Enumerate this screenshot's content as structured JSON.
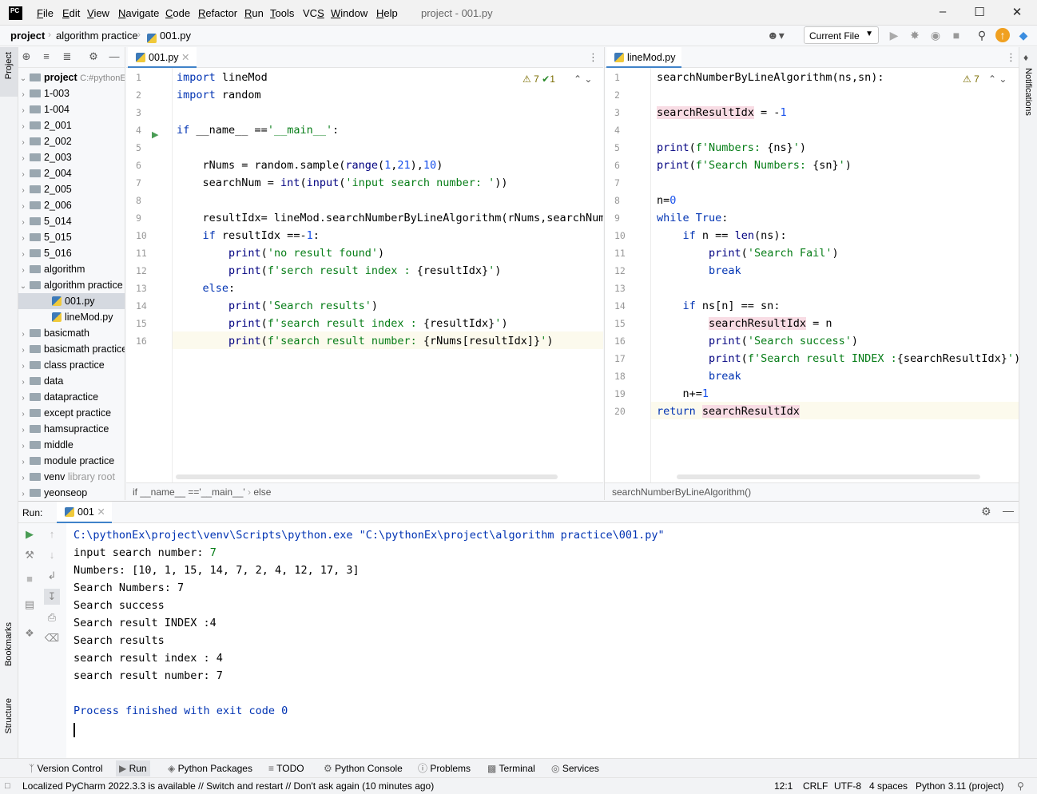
{
  "app": {
    "logo_text": "PC",
    "title": "project - 001.py"
  },
  "menu": [
    "File",
    "Edit",
    "View",
    "Navigate",
    "Code",
    "Refactor",
    "Run",
    "Tools",
    "VCS",
    "Window",
    "Help"
  ],
  "menu_mnemonic": [
    "F",
    "E",
    "V",
    "N",
    "C",
    "R",
    "R",
    "T",
    "S",
    "W",
    "H"
  ],
  "breadcrumb": [
    "project",
    "algorithm practice",
    "001.py"
  ],
  "run_config": "Current File",
  "left_strip": {
    "project": "Project",
    "bookmarks": "Bookmarks",
    "structure": "Structure"
  },
  "right_strip": {
    "notifications": "Notifications"
  },
  "project_tree": {
    "root_label": "project",
    "root_path": "C:#pythonEx",
    "items": [
      {
        "label": "1-003",
        "type": "folder",
        "depth": 0,
        "expanded": false
      },
      {
        "label": "1-004",
        "type": "folder",
        "depth": 0,
        "expanded": false
      },
      {
        "label": "2_001",
        "type": "folder",
        "depth": 0,
        "expanded": false
      },
      {
        "label": "2_002",
        "type": "folder",
        "depth": 0,
        "expanded": false
      },
      {
        "label": "2_003",
        "type": "folder",
        "depth": 0,
        "expanded": false
      },
      {
        "label": "2_004",
        "type": "folder",
        "depth": 0,
        "expanded": false
      },
      {
        "label": "2_005",
        "type": "folder",
        "depth": 0,
        "expanded": false
      },
      {
        "label": "2_006",
        "type": "folder",
        "depth": 0,
        "expanded": false
      },
      {
        "label": "5_014",
        "type": "folder",
        "depth": 0,
        "expanded": false
      },
      {
        "label": "5_015",
        "type": "folder",
        "depth": 0,
        "expanded": false
      },
      {
        "label": "5_016",
        "type": "folder",
        "depth": 0,
        "expanded": false
      },
      {
        "label": "algorithm",
        "type": "folder",
        "depth": 0,
        "expanded": false
      },
      {
        "label": "algorithm practice",
        "type": "folder",
        "depth": 0,
        "expanded": true
      },
      {
        "label": "001.py",
        "type": "py",
        "depth": 1,
        "selected": true
      },
      {
        "label": "lineMod.py",
        "type": "py",
        "depth": 1
      },
      {
        "label": "basicmath",
        "type": "folder",
        "depth": 0,
        "expanded": false
      },
      {
        "label": "basicmath practice",
        "type": "folder",
        "depth": 0,
        "expanded": false
      },
      {
        "label": "class practice",
        "type": "folder",
        "depth": 0,
        "expanded": false
      },
      {
        "label": "data",
        "type": "folder",
        "depth": 0,
        "expanded": false
      },
      {
        "label": "datapractice",
        "type": "folder",
        "depth": 0,
        "expanded": false
      },
      {
        "label": "except practice",
        "type": "folder",
        "depth": 0,
        "expanded": false
      },
      {
        "label": "hamsupractice",
        "type": "folder",
        "depth": 0,
        "expanded": false
      },
      {
        "label": "middle",
        "type": "folder",
        "depth": 0,
        "expanded": false
      },
      {
        "label": "module practice",
        "type": "folder",
        "depth": 0,
        "expanded": false
      },
      {
        "label": "venv",
        "type": "folder",
        "depth": 0,
        "expanded": false,
        "note": "library root"
      },
      {
        "label": "yeonseop",
        "type": "folder",
        "depth": 0,
        "expanded": false
      }
    ]
  },
  "editor_left": {
    "tab": "001.py",
    "warnings": "7",
    "checks": "1",
    "breadcrumb": [
      "if __name__ =='__main__'",
      "else"
    ],
    "lines": [
      "import lineMod",
      "import random",
      "",
      "if __name__ =='__main__':",
      "",
      "    rNums = random.sample(range(1,21),10)",
      "    searchNum = int(input('input search number: '))",
      "",
      "    resultIdx= lineMod.searchNumberByLineAlgorithm(rNums,searchNum)",
      "    if resultIdx ==-1:",
      "        print('no result found')",
      "        print(f'serch result index : {resultIdx}')",
      "    else:",
      "        print('Search results')",
      "        print(f'search result index : {resultIdx}')",
      "        print(f'search result number: {rNums[resultIdx]}')"
    ]
  },
  "editor_right": {
    "tab": "lineMod.py",
    "warnings": "7",
    "breadcrumb": "searchNumberByLineAlgorithm()",
    "lines": [
      "searchNumberByLineAlgorithm(ns,sn):",
      "",
      "searchResultIdx = -1",
      "",
      "print(f'Numbers: {ns}')",
      "print(f'Search Numbers: {sn}')",
      "",
      "n=0",
      "while True:",
      "    if n == len(ns):",
      "        print('Search Fail')",
      "        break",
      "",
      "    if ns[n] == sn:",
      "        searchResultIdx = n",
      "        print('Search success')",
      "        print(f'Search result INDEX :{searchResultIdx}')",
      "        break",
      "    n+=1",
      "return searchResultIdx"
    ]
  },
  "run_panel": {
    "label": "Run:",
    "tab": "001",
    "output": [
      {
        "text": "C:\\pythonEx\\project\\venv\\Scripts\\python.exe \"C:\\pythonEx\\project\\algorithm practice\\001.py\"",
        "kind": "cmd"
      },
      {
        "text": "input search number: ",
        "input": "7",
        "kind": "normal"
      },
      {
        "text": "Numbers: [10, 1, 15, 14, 7, 2, 4, 12, 17, 3]",
        "kind": "normal"
      },
      {
        "text": "Search Numbers: 7",
        "kind": "normal"
      },
      {
        "text": "Search success",
        "kind": "normal"
      },
      {
        "text": "Search result INDEX :4",
        "kind": "normal"
      },
      {
        "text": "Search results",
        "kind": "normal"
      },
      {
        "text": "search result index : 4",
        "kind": "normal"
      },
      {
        "text": "search result number: 7",
        "kind": "normal"
      },
      {
        "text": "",
        "kind": "normal"
      },
      {
        "text": "Process finished with exit code 0",
        "kind": "cmd"
      }
    ]
  },
  "bottom_tabs": [
    "Version Control",
    "Run",
    "Python Packages",
    "TODO",
    "Python Console",
    "Problems",
    "Terminal",
    "Services"
  ],
  "status": {
    "message": "Localized PyCharm 2022.3.3 is available // Switch and restart // Don't ask again (10 minutes ago)",
    "position": "12:1",
    "line_sep": "CRLF",
    "encoding": "UTF-8",
    "indent": "4 spaces",
    "interpreter": "Python 3.11 (project)"
  },
  "colors": {
    "keyword": "#0033b3",
    "string": "#067d17",
    "number": "#1750eb",
    "console_cmd": "#0033b3",
    "console_input": "#067d17"
  }
}
